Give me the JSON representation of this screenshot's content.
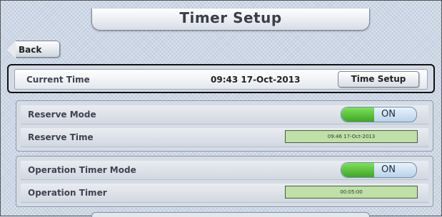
{
  "header": {
    "title": "Timer Setup"
  },
  "nav": {
    "back_label": "Back"
  },
  "current_time": {
    "label": "Current Time",
    "value": "09:43 17-Oct-2013",
    "button_label": "Time Setup"
  },
  "reserve": {
    "mode_label": "Reserve Mode",
    "mode_state": "ON",
    "time_label": "Reserve Time",
    "time_value": "09:46 17-Oct-2013"
  },
  "operation": {
    "mode_label": "Operation Timer Mode",
    "mode_state": "ON",
    "timer_label": "Operation Timer",
    "timer_value": "00:05:00"
  },
  "colors": {
    "toggle_on": "#4cba2e",
    "field_bg": "#bfe0a7",
    "highlight_border": "#111111"
  }
}
